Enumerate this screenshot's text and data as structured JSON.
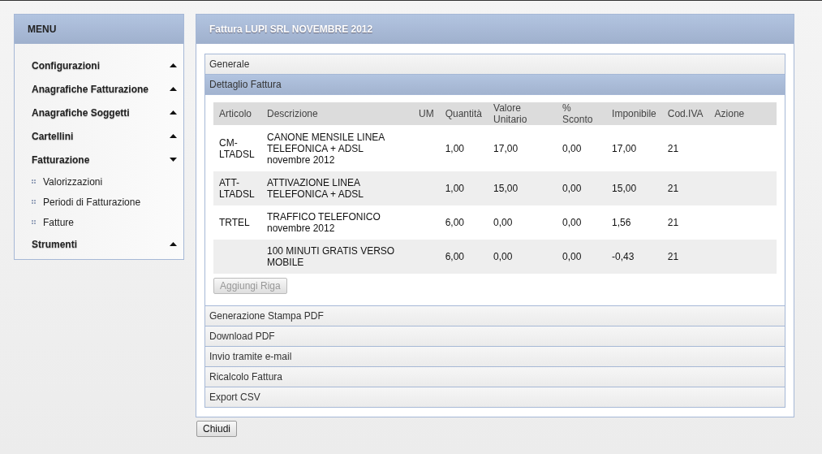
{
  "menu": {
    "title": "MENU",
    "items": [
      {
        "label": "Configurazioni",
        "expanded": false
      },
      {
        "label": "Anagrafiche Fatturazione",
        "expanded": false
      },
      {
        "label": "Anagrafiche Soggetti",
        "expanded": false
      },
      {
        "label": "Cartellini",
        "expanded": false
      },
      {
        "label": "Fatturazione",
        "expanded": true,
        "children": [
          {
            "label": "Valorizzazioni"
          },
          {
            "label": "Periodi di Fatturazione"
          },
          {
            "label": "Fatture"
          }
        ]
      },
      {
        "label": "Strumenti",
        "expanded": false
      }
    ]
  },
  "panel": {
    "title": "Fattura LUPI SRL NOVEMBRE 2012",
    "sections": [
      {
        "label": "Generale",
        "expanded": false
      },
      {
        "label": "Dettaglio Fattura",
        "expanded": true,
        "table": {
          "columns": [
            "Articolo",
            "Descrizione",
            "UM",
            "Quantità",
            "Valore Unitario",
            "% Sconto",
            "Imponibile",
            "Cod.IVA",
            "Azione"
          ],
          "rows": [
            [
              "CM-LTADSL",
              "CANONE MENSILE LINEA TELEFONICA + ADSL novembre 2012",
              "",
              "1,00",
              "17,00",
              "0,00",
              "17,00",
              "21",
              ""
            ],
            [
              "ATT-LTADSL",
              "ATTIVAZIONE LINEA TELEFONICA + ADSL",
              "",
              "1,00",
              "15,00",
              "0,00",
              "15,00",
              "21",
              ""
            ],
            [
              "TRTEL",
              "TRAFFICO TELEFONICO novembre 2012",
              "",
              "6,00",
              "0,00",
              "0,00",
              "1,56",
              "21",
              ""
            ],
            [
              "",
              "100 MINUTI GRATIS VERSO MOBILE",
              "",
              "6,00",
              "0,00",
              "0,00",
              "-0,43",
              "21",
              ""
            ]
          ]
        },
        "add_button": {
          "label": "Aggiungi Riga",
          "disabled": true
        }
      },
      {
        "label": "Generazione Stampa PDF",
        "expanded": false
      },
      {
        "label": "Download PDF",
        "expanded": false
      },
      {
        "label": "Invio tramite e-mail",
        "expanded": false
      },
      {
        "label": "Ricalcolo Fattura",
        "expanded": false
      },
      {
        "label": "Export CSV",
        "expanded": false
      }
    ]
  },
  "close_button": {
    "label": "Chiudi"
  }
}
